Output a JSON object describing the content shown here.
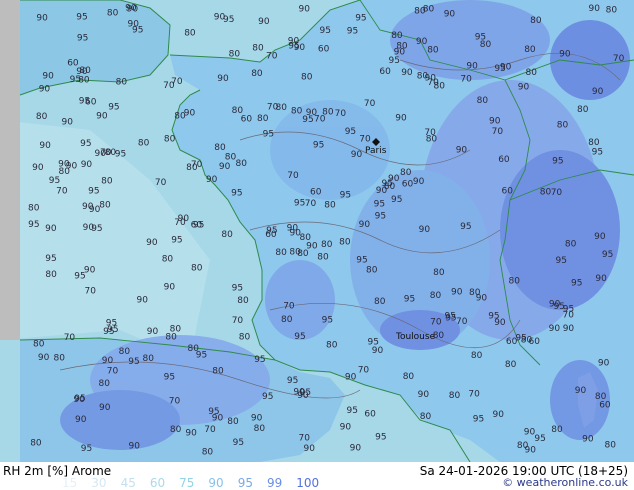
{
  "footer": {
    "title": "RH 2m [%] Arome",
    "timestamp": "Sa 24-01-2026 19:00 UTC (18+25)",
    "credit": "© weatheronline.co.uk"
  },
  "legend": {
    "values": [
      "15",
      "30",
      "45",
      "60",
      "75",
      "90",
      "95",
      "99",
      "100"
    ],
    "colors": [
      "#e4f1f8",
      "#d3e9f3",
      "#c2e1ee",
      "#aad9ea",
      "#92d3e6",
      "#86c2ea",
      "#78aaea",
      "#6a8ee4",
      "#5670dc"
    ]
  },
  "map": {
    "cities": [
      "Paris",
      "Toulouse"
    ],
    "isoline_labels": [
      "80",
      "90",
      "90",
      "95",
      "90",
      "95",
      "90",
      "80",
      "90",
      "90",
      "95",
      "90",
      "80",
      "90",
      "80",
      "70",
      "90",
      "80",
      "90",
      "80",
      "80",
      "90",
      "70",
      "90",
      "80",
      "90",
      "95",
      "90",
      "70",
      "80",
      "95",
      "90",
      "95",
      "95",
      "90",
      "90",
      "80",
      "95",
      "90",
      "80",
      "95",
      "90",
      "70",
      "80",
      "90",
      "90",
      "95",
      "95",
      "90",
      "95",
      "90",
      "80",
      "90",
      "95",
      "90",
      "95",
      "90",
      "95",
      "90",
      "80",
      "95",
      "95",
      "90",
      "80",
      "95",
      "90",
      "80",
      "70",
      "60",
      "80",
      "95",
      "80",
      "90",
      "80",
      "90",
      "95",
      "80",
      "80",
      "70",
      "95",
      "95",
      "90",
      "90",
      "95",
      "70",
      "70",
      "95",
      "90",
      "90",
      "80",
      "90",
      "95",
      "90",
      "80",
      "80",
      "90",
      "80",
      "90",
      "80",
      "70",
      "90",
      "90",
      "90",
      "95",
      "90",
      "80",
      "95",
      "95",
      "90",
      "95",
      "95",
      "80",
      "70",
      "60",
      "95",
      "70",
      "80",
      "90",
      "70",
      "90",
      "95",
      "80",
      "95",
      "80",
      "95",
      "90",
      "80",
      "80",
      "60",
      "95",
      "95",
      "95",
      "70",
      "90",
      "95",
      "90",
      "80",
      "95",
      "90",
      "80",
      "95",
      "80",
      "95",
      "80",
      "90",
      "80",
      "90",
      "95",
      "90",
      "95",
      "95",
      "80",
      "90",
      "95",
      "80",
      "95",
      "80",
      "95",
      "95",
      "70",
      "80",
      "60",
      "95",
      "90",
      "90",
      "95",
      "70",
      "80",
      "90",
      "90",
      "60",
      "60",
      "90",
      "80",
      "80",
      "70",
      "60",
      "70",
      "80",
      "70",
      "90",
      "80",
      "90",
      "90",
      "90",
      "95",
      "90",
      "95",
      "80",
      "80",
      "95",
      "80",
      "95",
      "90",
      "95",
      "95",
      "95",
      "80",
      "95",
      "90",
      "90",
      "95",
      "95",
      "80",
      "90",
      "90",
      "80",
      "90",
      "80",
      "80",
      "90",
      "80",
      "90",
      "70",
      "80",
      "95",
      "95",
      "80",
      "95",
      "90",
      "80",
      "70",
      "80",
      "90",
      "80",
      "80",
      "60",
      "80",
      "80",
      "70",
      "80",
      "90",
      "80",
      "90",
      "80",
      "95",
      "90",
      "90",
      "95",
      "95",
      "80",
      "90",
      "90",
      "80",
      "80",
      "90",
      "60",
      "70",
      "80",
      "60",
      "80",
      "90",
      "90",
      "80",
      "80",
      "80",
      "70",
      "70",
      "70",
      "60",
      "80",
      "80",
      "80",
      "70",
      "70",
      "80",
      "60",
      "70",
      "80",
      "60",
      "80",
      "80",
      "95",
      "90",
      "80",
      "95",
      "90",
      "95",
      "90",
      "80",
      "70",
      "60",
      "95",
      "80",
      "80",
      "80",
      "95",
      "90",
      "95",
      "70",
      "80",
      "70",
      "80",
      "80",
      "70",
      "80",
      "60",
      "90",
      "80",
      "80",
      "90",
      "80",
      "70",
      "70",
      "80"
    ]
  }
}
